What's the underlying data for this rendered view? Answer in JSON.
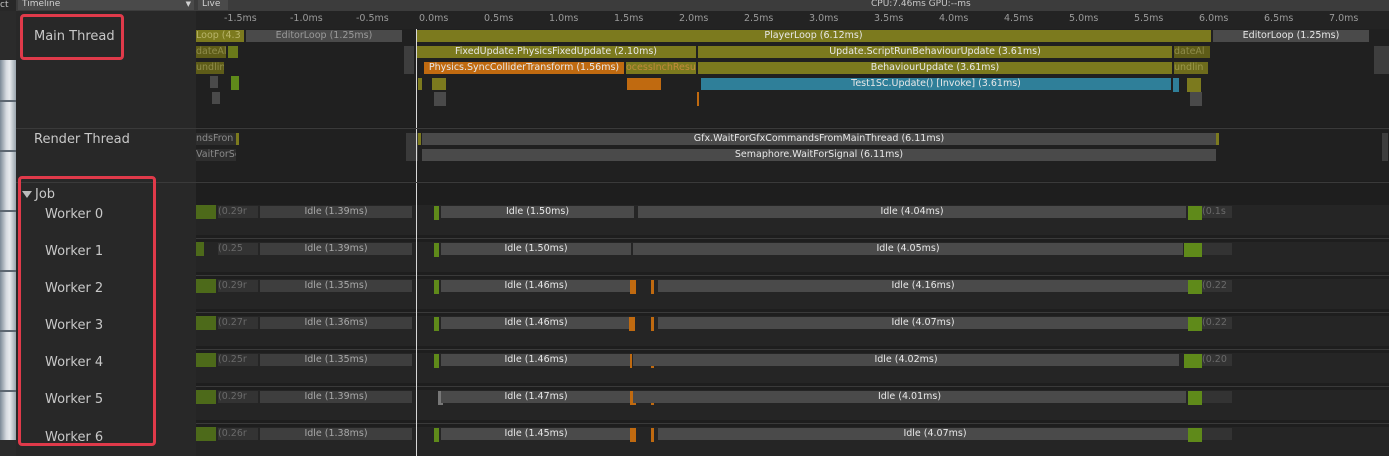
{
  "app": {
    "view_label": "Timeline",
    "live_label": "Live",
    "edge_label": "ct",
    "cpu_gpu": "CPU:7.46ms   GPU:--ms"
  },
  "ruler": [
    "-1.5ms",
    "-1.0ms",
    "-0.5ms",
    "0.0ms",
    "0.5ms",
    "1.0ms",
    "1.5ms",
    "2.0ms",
    "2.5ms",
    "3.0ms",
    "3.5ms",
    "4.0ms",
    "4.5ms",
    "5.0ms",
    "5.5ms",
    "6.0ms",
    "6.5ms",
    "7.0ms"
  ],
  "threads": {
    "main": "Main Thread",
    "render": "Render Thread",
    "job_group": "Job",
    "workers": [
      "Worker 0",
      "Worker 1",
      "Worker 2",
      "Worker 3",
      "Worker 4",
      "Worker 5",
      "Worker 6"
    ]
  },
  "main_blocks": {
    "loop_left": "Loop (4.3",
    "editorloop_left": "EditorLoop (1.25ms)",
    "playerloop": "PlayerLoop (6.12ms)",
    "editorloop_right": "EditorLoop (1.25ms)",
    "dateA_left": "dateAl",
    "fixedupdate": "FixedUpdate.PhysicsFixedUpdate (2.10ms)",
    "scriptrun": "Update.ScriptRunBehaviourUpdate (3.61ms)",
    "dateA_right": "dateAl",
    "undl_left": "undlin",
    "syncollider": "Physics.SyncColliderTransform (1.56ms)",
    "processinch": "ocessInchResu",
    "behaviourupdate": "BehaviourUpdate (3.61ms)",
    "undl_right": "undlin",
    "test1sc": "Test1SC.Update() [Invoke] (3.61ms)"
  },
  "render_blocks": {
    "left1": "ndsFron",
    "waitgfx": "Gfx.WaitForGfxCommandsFromMainThread (6.11ms)",
    "left2": "VaitForSe",
    "semaphore": "Semaphore.WaitForSignal (6.11ms)"
  },
  "workers": [
    {
      "pre": "(0.29r",
      "idle_a": "Idle (1.39ms)",
      "idle_b": "Idle (1.50ms)",
      "idle_c": "Idle (4.04ms)",
      "tail": "(0.1s"
    },
    {
      "pre": "(0.25",
      "idle_a": "Idle (1.39ms)",
      "idle_b": "Idle (1.50ms)",
      "idle_c": "Idle (4.05ms)",
      "tail": ""
    },
    {
      "pre": "(0.29r",
      "idle_a": "Idle (1.35ms)",
      "idle_b": "Idle (1.46ms)",
      "idle_c": "Idle (4.16ms)",
      "tail": "(0.22"
    },
    {
      "pre": "(0.27r",
      "idle_a": "Idle (1.36ms)",
      "idle_b": "Idle (1.46ms)",
      "idle_c": "Idle (4.07ms)",
      "tail": "(0.22"
    },
    {
      "pre": "(0.25r",
      "idle_a": "Idle (1.35ms)",
      "idle_b": "Idle (1.46ms)",
      "idle_c": "Idle (4.02ms)",
      "tail": "(0.20"
    },
    {
      "pre": "(0.29r",
      "idle_a": "Idle (1.39ms)",
      "idle_b": "Idle (1.47ms)",
      "idle_c": "Idle (4.01ms)",
      "tail": ""
    },
    {
      "pre": "(0.26r",
      "idle_a": "Idle (1.38ms)",
      "idle_b": "Idle (1.45ms)",
      "idle_c": "Idle (4.07ms)",
      "tail": ""
    }
  ],
  "colors": {
    "olive": "#7c7a1e",
    "olive_dark": "#5e5c18",
    "orange": "#c06a10",
    "teal": "#2f7f99",
    "gray_block": "#4a4a4a",
    "green": "#5f8a1a",
    "highlight": "#e03a4a"
  }
}
